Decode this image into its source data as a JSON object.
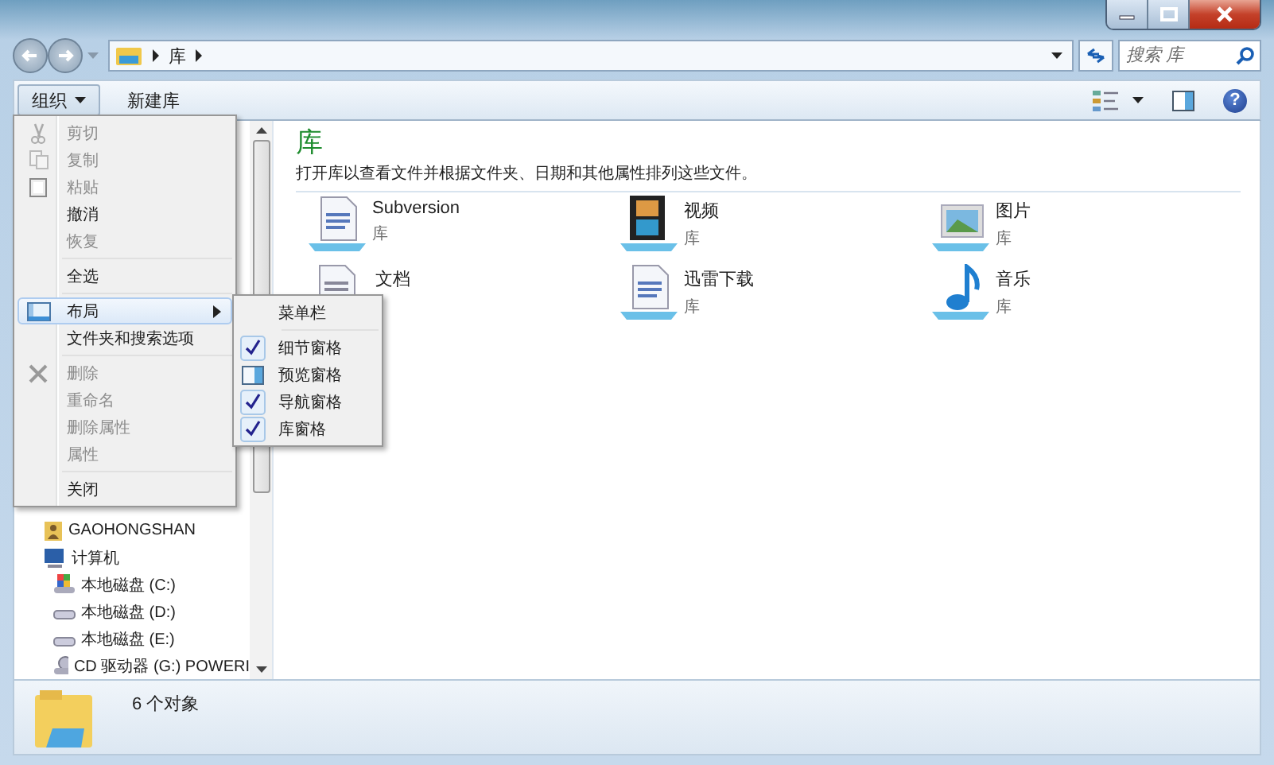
{
  "window": {
    "controls": [
      {
        "kind": "minimize"
      },
      {
        "kind": "maximize"
      },
      {
        "kind": "close"
      }
    ]
  },
  "address_bar": {
    "crumbs": [
      "库"
    ],
    "search_placeholder": "搜索 库"
  },
  "toolbar": {
    "buttons": [
      {
        "label": "组织",
        "has_dropdown": true
      },
      {
        "label": "新建库",
        "has_dropdown": false
      }
    ],
    "help": "?"
  },
  "sidebar": {
    "items": [
      {
        "label": "GAOHONGSHAN"
      },
      {
        "label": "计算机",
        "children": [
          {
            "label": "本地磁盘 (C:)"
          },
          {
            "label": "本地磁盘 (D:)"
          },
          {
            "label": "本地磁盘 (E:)"
          },
          {
            "label": "CD 驱动器 (G:) POWERI"
          }
        ]
      }
    ]
  },
  "content": {
    "title": "库",
    "description": "打开库以查看文件并根据文件夹、日期和其他属性排列这些文件。",
    "libraries": [
      {
        "name": "Subversion",
        "type": "库"
      },
      {
        "name": "视频",
        "type": "库"
      },
      {
        "name": "图片",
        "type": "库"
      },
      {
        "name": "文档"
      },
      {
        "name": "迅雷下载",
        "type": "库"
      },
      {
        "name": "音乐",
        "type": "库"
      }
    ]
  },
  "menu": {
    "groups": [
      [
        {
          "label": "剪切",
          "disabled": true,
          "selected": false,
          "has_submenu": false
        },
        {
          "label": "复制",
          "disabled": true,
          "selected": false,
          "has_submenu": false
        },
        {
          "label": "粘贴",
          "disabled": true,
          "selected": false,
          "has_submenu": false
        },
        {
          "label": "撤消",
          "disabled": false,
          "selected": false,
          "has_submenu": false
        },
        {
          "label": "恢复",
          "disabled": true,
          "selected": false,
          "has_submenu": false
        }
      ],
      [
        {
          "label": "全选",
          "disabled": false,
          "selected": false,
          "has_submenu": false
        }
      ],
      [
        {
          "label": "布局",
          "disabled": false,
          "selected": true,
          "has_submenu": true
        },
        {
          "label": "文件夹和搜索选项",
          "disabled": false,
          "selected": false,
          "has_submenu": false
        }
      ],
      [
        {
          "label": "删除",
          "disabled": true,
          "selected": false,
          "has_submenu": false
        },
        {
          "label": "重命名",
          "disabled": true,
          "selected": false,
          "has_submenu": false
        },
        {
          "label": "删除属性",
          "disabled": true,
          "selected": false,
          "has_submenu": false
        },
        {
          "label": "属性",
          "disabled": true,
          "selected": false,
          "has_submenu": false
        }
      ],
      [
        {
          "label": "关闭",
          "disabled": false,
          "selected": false,
          "has_submenu": false
        }
      ]
    ]
  },
  "submenu": {
    "groups": [
      [
        {
          "label": "菜单栏",
          "kind": "check",
          "checked": false
        }
      ],
      [
        {
          "label": "细节窗格",
          "kind": "check",
          "checked": true
        },
        {
          "label": "预览窗格",
          "kind": "icon"
        },
        {
          "label": "导航窗格",
          "kind": "check",
          "checked": true
        },
        {
          "label": "库窗格",
          "kind": "check",
          "checked": true
        }
      ]
    ]
  },
  "status_bar": {
    "text": "6 个对象"
  }
}
